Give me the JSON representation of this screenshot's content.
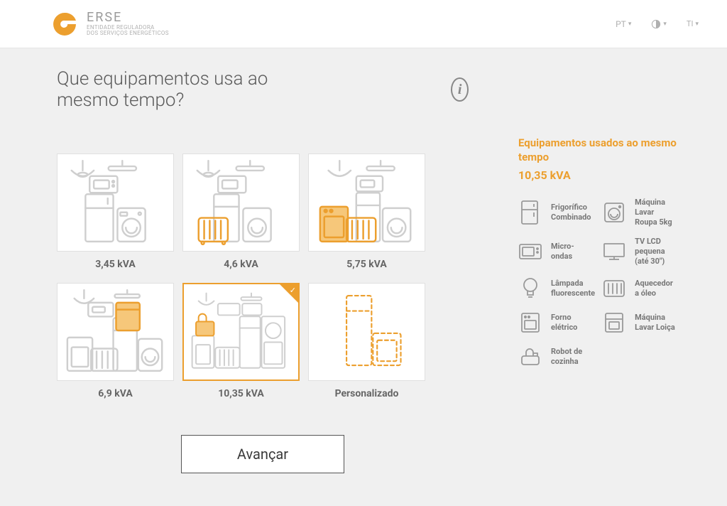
{
  "brand": {
    "name": "ERSE",
    "tagline1": "ENTIDADE REGULADORA",
    "tagline2": "DOS SERVIÇOS ENERGÉTICOS"
  },
  "topbar": {
    "lang": "PT"
  },
  "heading": "Que equipamentos usa ao mesmo tempo?",
  "cards": [
    {
      "label": "3,45 kVA"
    },
    {
      "label": "4,6 kVA"
    },
    {
      "label": "5,75 kVA"
    },
    {
      "label": "6,9 kVA"
    },
    {
      "label": "10,35 kVA"
    },
    {
      "label": "Personalizado"
    }
  ],
  "selected_index": 4,
  "right": {
    "title": "Equipamentos usados ao mesmo tempo",
    "kva": "10,35 kVA",
    "items": [
      "Frigorífico Combinado",
      "Máquina Lavar Roupa 5kg",
      "Micro-ondas",
      "TV LCD pequena (até 30\")",
      "Lâmpada fluorescente",
      "Aquecedor a óleo",
      "Forno elétrico",
      "Máquina Lavar Loiça",
      "Robot de cozinha"
    ]
  },
  "advance": "Avançar",
  "colors": {
    "accent": "#ec9f2e",
    "muted": "#cfcfcf"
  }
}
